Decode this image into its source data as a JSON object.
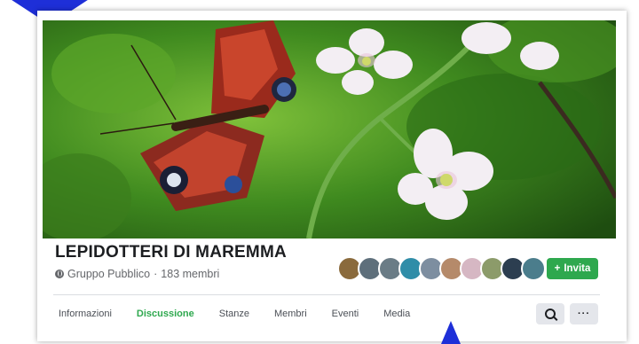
{
  "group": {
    "name": "LEPIDOTTERI DI MAREMMA",
    "privacy": "Gruppo Pubblico",
    "separator": "·",
    "members": "183 membri"
  },
  "actions": {
    "invite_label": "Invita",
    "invite_icon": "+",
    "more_label": "···"
  },
  "tabs": [
    {
      "label": "Informazioni",
      "active": false
    },
    {
      "label": "Discussione",
      "active": true
    },
    {
      "label": "Stanze",
      "active": false
    },
    {
      "label": "Membri",
      "active": false
    },
    {
      "label": "Eventi",
      "active": false
    },
    {
      "label": "Media",
      "active": false
    }
  ],
  "member_avatar_colors": [
    "#8a6a3c",
    "#5e6f7b",
    "#6a7c86",
    "#2f8da8",
    "#7d8ea0",
    "#b58a6a",
    "#d6b7c3",
    "#8c9b6a",
    "#2c3e50",
    "#4b7d8c"
  ],
  "colors": {
    "accent": "#2ea84e",
    "text_primary": "#1c1e21",
    "text_secondary": "#65676b",
    "decor_star": "#1e2fd8"
  },
  "icons": {
    "globe": "globe-icon",
    "search": "search-icon",
    "more": "more-icon",
    "plus": "plus-icon"
  }
}
